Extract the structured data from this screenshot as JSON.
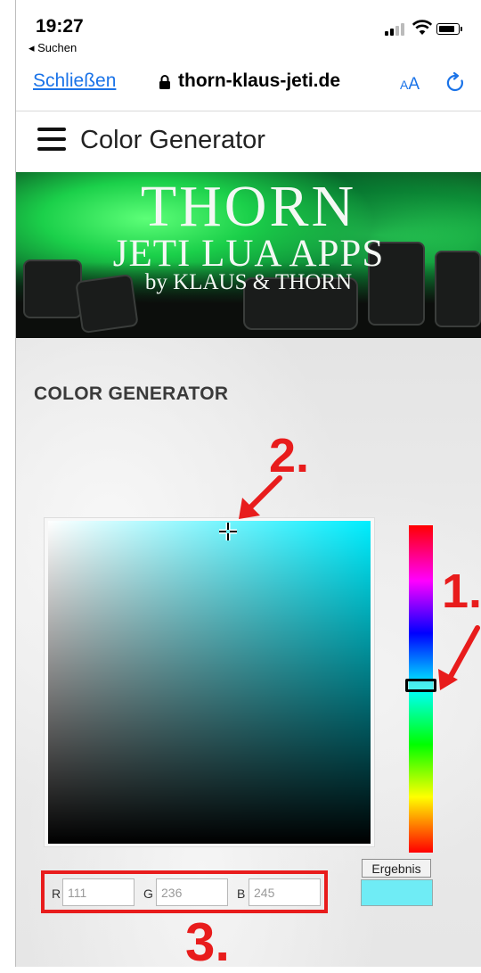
{
  "status_bar": {
    "time": "19:27",
    "back_label": "◂ Suchen"
  },
  "browser": {
    "close_label": "Schließen",
    "url": "thorn-klaus-jeti.de",
    "aa_small": "A",
    "aa_big": "A"
  },
  "site": {
    "title": "Color Generator"
  },
  "banner": {
    "line1": "THORN",
    "line2": "JETI LUA APPS",
    "line3": "by KLAUS & THORN"
  },
  "section": {
    "title": "COLOR GENERATOR"
  },
  "picker": {
    "hue_color": "#00eeff",
    "hue_position": 0.49
  },
  "inputs": {
    "r_label": "R",
    "r_value": "111",
    "g_label": "G",
    "g_value": "236",
    "b_label": "B",
    "b_value": "245"
  },
  "result": {
    "label": "Ergebnis",
    "color": "#6fecf5"
  },
  "annotations": {
    "one": "1.",
    "two": "2.",
    "three": "3.",
    "color": "#e81c1c"
  },
  "colors": {
    "link": "#1a73e8"
  }
}
